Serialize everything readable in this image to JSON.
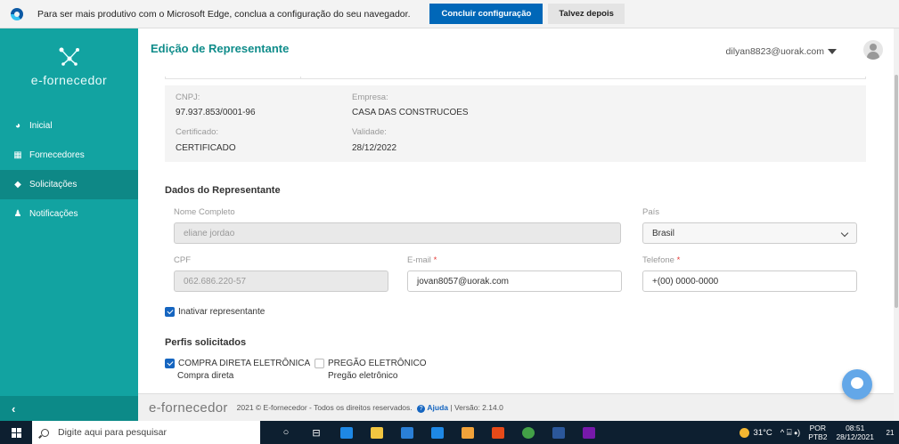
{
  "edge_banner": {
    "message": "Para ser mais produtivo com o Microsoft Edge, conclua a configuração do seu navegador.",
    "primary_button": "Concluir configuração",
    "secondary_button": "Talvez depois"
  },
  "sidebar": {
    "logo_text": "e-fornecedor",
    "items": [
      {
        "label": "Inicial",
        "icon": "dashboard-icon",
        "glyph": "◕"
      },
      {
        "label": "Fornecedores",
        "icon": "building-icon",
        "glyph": "▦"
      },
      {
        "label": "Solicitações",
        "icon": "tag-icon",
        "glyph": "◆"
      },
      {
        "label": "Notificações",
        "icon": "bell-icon",
        "glyph": "♟"
      }
    ],
    "active_index": 2,
    "collapse_glyph": "‹"
  },
  "header": {
    "title": "Edição de Representante",
    "user_email": "dilyan8823@uorak.com"
  },
  "company": {
    "cnpj_label": "CNPJ:",
    "cnpj_value": "97.937.853/0001-96",
    "empresa_label": "Empresa:",
    "empresa_value": "CASA DAS CONSTRUCOES",
    "certificado_label": "Certificado:",
    "certificado_value": "CERTIFICADO",
    "validade_label": "Validade:",
    "validade_value": "28/12/2022"
  },
  "representante": {
    "section_title": "Dados do Representante",
    "nome_label": "Nome Completo",
    "nome_value": "eliane jordao",
    "pais_label": "País",
    "pais_value": "Brasil",
    "cpf_label": "CPF",
    "cpf_value": "062.686.220-57",
    "email_label": "E-mail",
    "email_value": "jovan8057@uorak.com",
    "telefone_label": "Telefone",
    "telefone_value": "+(00) 0000-0000",
    "required_mark": "*",
    "inativar_label": "Inativar representante",
    "inativar_checked": true
  },
  "perfis": {
    "section_title": "Perfis solicitados",
    "items": [
      {
        "label": "COMPRA DIRETA ELETRÔNICA",
        "sub": "Compra direta",
        "checked": true
      },
      {
        "label": "PREGÃO ELETRÔNICO",
        "sub": "Pregão eletrônico",
        "checked": false
      }
    ]
  },
  "footer": {
    "logo": "e-fornecedor",
    "copyright": "2021 © E-fornecedor - Todos os direitos reservados.",
    "help_link": "Ajuda",
    "version": "| Versão: 2.14.0"
  },
  "taskbar": {
    "search_placeholder": "Digite aqui para pesquisar",
    "temperature": "31°C",
    "tray_glyphs": "^ ⌸ ⦁)",
    "lang_top": "POR",
    "lang_bottom": "PTB2",
    "time": "08:51",
    "date": "28/12/2021",
    "notif_count": "21",
    "apps": [
      {
        "icon": "cortana-icon",
        "glyph": "○"
      },
      {
        "icon": "task-view-icon",
        "glyph": "⊟"
      },
      {
        "icon": "edge-icon",
        "color": "#1e88e5"
      },
      {
        "icon": "file-explorer-icon",
        "color": "#f2c641"
      },
      {
        "icon": "store-icon",
        "color": "#2a7fd6"
      },
      {
        "icon": "mail-icon",
        "color": "#1e88e5"
      },
      {
        "icon": "paint-icon",
        "color": "#f2a33a"
      },
      {
        "icon": "app-icon",
        "color": "#e64a19"
      },
      {
        "icon": "chrome-icon",
        "color": "#43a047"
      },
      {
        "icon": "word-icon",
        "color": "#2b579a"
      },
      {
        "icon": "onenote-icon",
        "color": "#7719aa"
      }
    ]
  }
}
